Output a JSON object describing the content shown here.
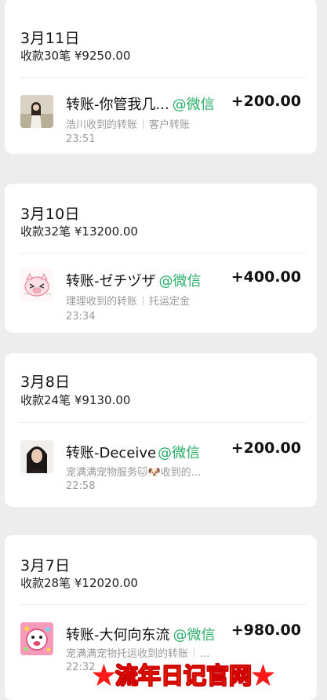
{
  "days": [
    {
      "date": "3月11日",
      "summary": "收款30笔 ¥9250.00",
      "txn": {
        "title": "转账-你管我几...",
        "source": "@微信",
        "amount": "+200.00",
        "receiver": "浩川收到的转账",
        "note": "客户转账",
        "time": "23:51",
        "avatar": "girl-outdoor-photo"
      }
    },
    {
      "date": "3月10日",
      "summary": "收款32笔 ¥13200.00",
      "txn": {
        "title": "转账-ゼチヅザ",
        "source": "@微信",
        "amount": "+400.00",
        "receiver": "理理收到的转账",
        "note": "托运定金",
        "time": "23:34",
        "avatar": "cartoon-pig-sticker"
      }
    },
    {
      "date": "3月8日",
      "summary": "收款24笔 ¥9130.00",
      "txn": {
        "title": "转账-Deceive",
        "source": "@微信",
        "amount": "+200.00",
        "receiver": "宠满满宠物服务🐱🐶收到的...",
        "note": "",
        "time": "22:58",
        "avatar": "woman-portrait-photo"
      }
    },
    {
      "date": "3月7日",
      "summary": "收款28笔 ¥12020.00",
      "txn": {
        "title": "转账-大何向东流",
        "source": "@微信",
        "amount": "+980.00",
        "receiver": "宠满满宠物托运收到的转账",
        "note": "...",
        "time": "22:32",
        "avatar": "pink-cartoon-face"
      }
    }
  ],
  "watermark": {
    "star_left": "★",
    "text": "流年日记官网",
    "star_right": "★"
  },
  "colors": {
    "background": "#ededed",
    "card": "#ffffff",
    "wechat_green": "#2aae67",
    "secondary_text": "#9a9a9a",
    "watermark_fill": "#ffe600",
    "watermark_stroke": "#d40000"
  }
}
